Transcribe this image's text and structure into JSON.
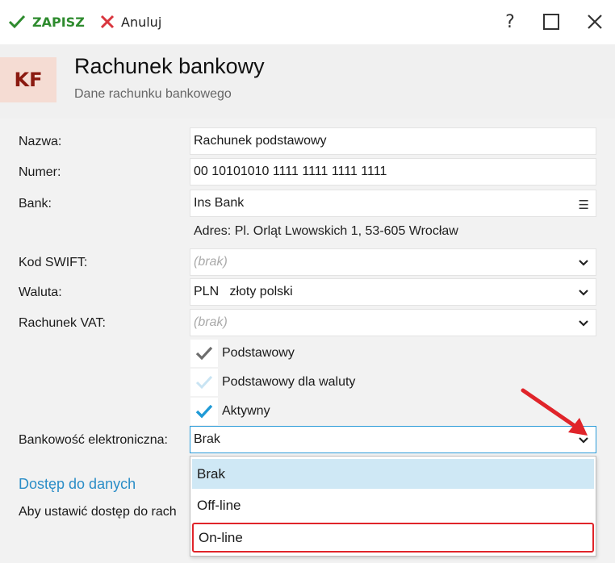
{
  "toolbar": {
    "save_label": "ZAPISZ",
    "cancel_label": "Anuluj",
    "colors": {
      "save": "#2e8b2e",
      "cancel": "#d9363e"
    }
  },
  "header": {
    "badge": "KF",
    "title": "Rachunek bankowy",
    "subtitle": "Dane rachunku bankowego"
  },
  "form": {
    "name_label": "Nazwa:",
    "name_value": "Rachunek podstawowy",
    "number_label": "Numer:",
    "number_value": "00 10101010 1111 1111 1111 1111",
    "bank_label": "Bank:",
    "bank_value": "Ins Bank",
    "address": "Adres:  Pl. Orląt Lwowskich 1, 53-605 Wrocław",
    "swift_label": "Kod SWIFT:",
    "swift_value": "(brak)",
    "currency_label": "Waluta:",
    "currency_value": "PLN   złoty polski",
    "vat_label": "Rachunek VAT:",
    "vat_value": "(brak)",
    "checkboxes": [
      {
        "label": "Podstawowy",
        "state": "checked-disabled"
      },
      {
        "label": "Podstawowy dla waluty",
        "state": "unchecked-disabled"
      },
      {
        "label": "Aktywny",
        "state": "checked"
      }
    ],
    "ebank_label": "Bankowość elektroniczna:",
    "ebank_value": "Brak",
    "ebank_options": [
      "Brak",
      "Off-line",
      "On-line"
    ],
    "ebank_selected": "Brak",
    "ebank_highlighted": "On-line"
  },
  "access": {
    "link": "Dostęp do danych",
    "text": "Aby ustawić dostęp do rach"
  },
  "colors": {
    "accent": "#2b9bd8",
    "link": "#2a8dc7",
    "annotation": "#e0242a",
    "badge_bg": "#f5dcd3",
    "badge_fg": "#8b1a10"
  }
}
